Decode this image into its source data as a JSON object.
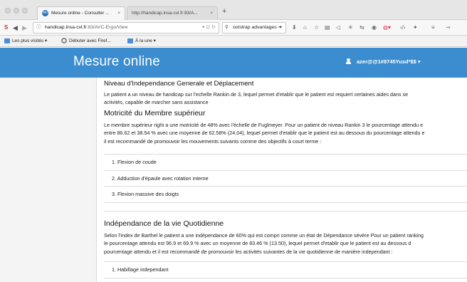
{
  "browser": {
    "tabs": [
      {
        "favicon": "Mo",
        "label": "Mesure online - Consulter ...",
        "close": "×"
      },
      {
        "label": "http://handicap.insa-cvl.fr:83/A...",
        "close": "×"
      }
    ],
    "new_tab": "+",
    "url_host": "handicap.insa-cvl.fr",
    "url_path": ":83/AVC-Ergo/View",
    "url_info_icon": "ⓘ",
    "search_text": "ootstrap advantages",
    "bookmarks": [
      {
        "label": "Les plus visités ▾"
      },
      {
        "label": "Débuter avec Firef..."
      },
      {
        "label": "À la une ▾"
      }
    ]
  },
  "app": {
    "title": "Mesure online",
    "user": "azer@@1#8745Yusd*$$ ▾"
  },
  "content": {
    "section1": {
      "title": "Niveau d'Independance Generale et Déplacement",
      "lines": [
        "Le patient a un niveau de handicap sur l'echelle Rankin de 3, lequel permet d'etablir que le patient est requiert certaines aides dans se",
        "activités, capable de marcher sans assistance"
      ]
    },
    "section2": {
      "title": "Motricité du Membre supérieur",
      "lines": [
        "Le membre supérieur right a une motricité de 48% avec l'échelle de Fuglmeyer. Pour un patient de niveau Rankin 3 le pourcentage attendu e",
        "entre 86.62 et 38.54 % avec une moyenne de 62.58% (24.04), lequel permet d'etablir que le patient est au dessous du pourcentage attendu e",
        "il est recommandé de promouvoir les mouvements suivants comme des objectifs à court terme :"
      ],
      "items": [
        "1. Flexion de coude",
        "2. Adduction d'épaule avec rotation interne",
        "3. Flexion massive des doigts"
      ]
    },
    "section3": {
      "title": "Indépendance de la vie Quotidienne",
      "lines": [
        "Selon l'index de Barthel le patient a une indépendance de 60% qui est compri comme un état de Dépendance sévère Pour un patient ranking",
        "le pourcentage attendu est 96.9 et 69.9 % avec un moyenne de 83.46 % (13.50), lequel permet d'etablir que le patient est au dessous d",
        "pourcentage attendu et il est recommandé de promouvoir les activités suivantes de la vie quotidienne de manière independant :"
      ],
      "items": [
        "1. Habillage independant"
      ]
    }
  },
  "colors": {
    "header_bg": "#3c8dcf",
    "sidebar_bg": "#f4f4f4"
  }
}
